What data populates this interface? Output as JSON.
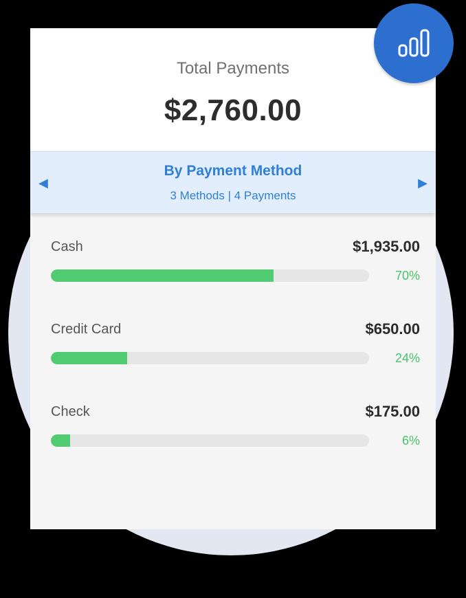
{
  "summary": {
    "label": "Total Payments",
    "amount": "$2,760.00"
  },
  "grouping": {
    "title": "By Payment Method",
    "subtitle": "3 Methods | 4 Payments",
    "prev_icon": "triangle-left-icon",
    "next_icon": "triangle-right-icon"
  },
  "methods": [
    {
      "label": "Cash",
      "amount": "$1,935.00",
      "percent_text": "70%",
      "fraction": 0.7
    },
    {
      "label": "Credit Card",
      "amount": "$650.00",
      "percent_text": "24%",
      "fraction": 0.24
    },
    {
      "label": "Check",
      "amount": "$175.00",
      "percent_text": "6%",
      "fraction": 0.06
    }
  ],
  "fab": {
    "icon": "bar-chart-icon"
  },
  "colors": {
    "accent": "#2f7fd6",
    "progress_fill": "#52cc72",
    "progress_track": "#e6e6e6",
    "fab_bg": "#2d6fcf"
  }
}
